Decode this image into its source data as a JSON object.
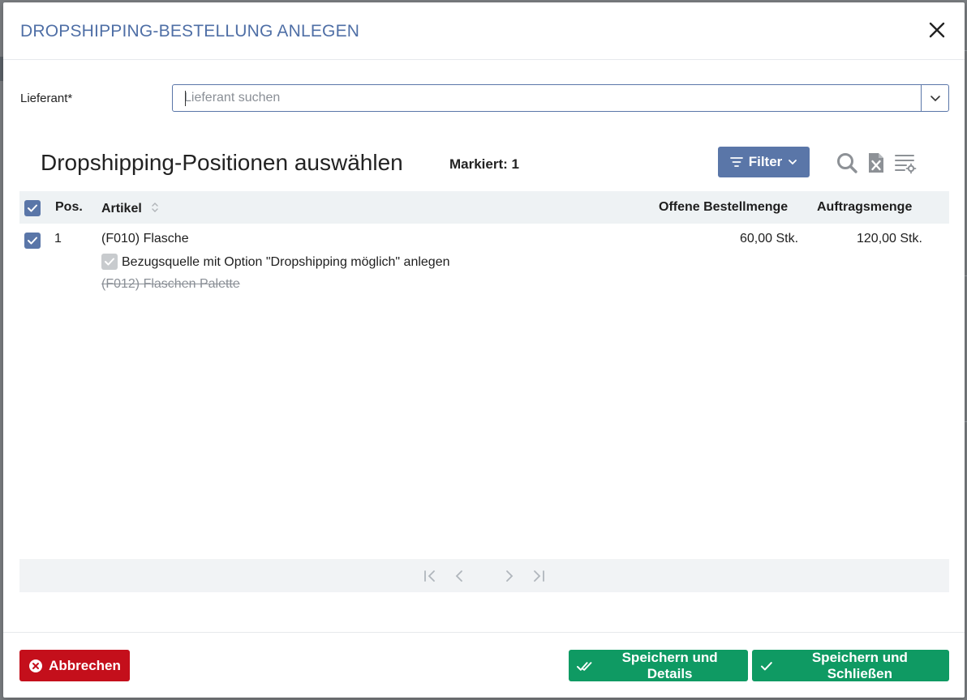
{
  "modal": {
    "title": "DROPSHIPPING-BESTELLUNG ANLEGEN"
  },
  "supplier": {
    "label": "Lieferant*",
    "placeholder": "Lieferant suchen",
    "value": ""
  },
  "section": {
    "title": "Dropshipping-Positionen auswählen",
    "marked": "Markiert: 1",
    "filter_label": "Filter"
  },
  "icons": {
    "search": "search-icon",
    "excel": "excel-export-icon",
    "columns": "column-settings-icon"
  },
  "table": {
    "headers": {
      "pos": "Pos.",
      "article": "Artikel",
      "open_qty": "Offene Bestellmenge",
      "order_qty": "Auftragsmenge"
    },
    "rows": [
      {
        "pos": "1",
        "article": "(F010) Flasche",
        "option": "Bezugsquelle mit Option \"Dropshipping möglich\" anlegen",
        "sub_article": "(F012) Flaschen Palette",
        "open_qty": "60,00 Stk.",
        "order_qty": "120,00 Stk."
      }
    ]
  },
  "footer": {
    "cancel": "Abbrechen",
    "save_details": "Speichern und Details",
    "save_close": "Speichern und Schließen"
  },
  "colors": {
    "accent": "#5a76a8",
    "danger": "#c40f1b",
    "success": "#0f9a63",
    "title": "#4f6fa6"
  }
}
